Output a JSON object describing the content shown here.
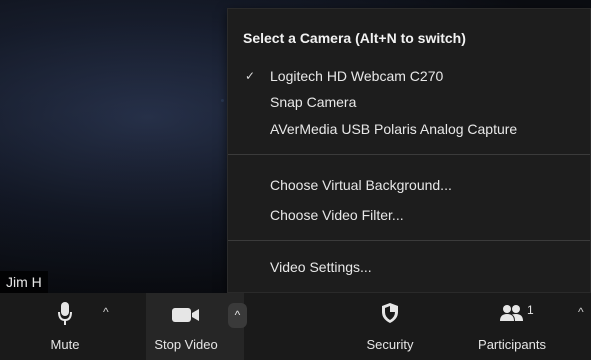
{
  "participant": {
    "name": "Jim H"
  },
  "camera_menu": {
    "title": "Select a Camera (Alt+N to switch)",
    "cameras": [
      {
        "label": "Logitech HD Webcam C270",
        "selected": true,
        "check": "✓"
      },
      {
        "label": "Snap Camera",
        "selected": false,
        "check": ""
      },
      {
        "label": "AVerMedia USB Polaris Analog Capture",
        "selected": false,
        "check": ""
      }
    ],
    "options": [
      {
        "label": "Choose Virtual Background..."
      },
      {
        "label": "Choose Video Filter..."
      }
    ],
    "settings_label": "Video Settings..."
  },
  "toolbar": {
    "mute_label": "Mute",
    "stop_video_label": "Stop Video",
    "security_label": "Security",
    "participants_label": "Participants",
    "participants_count": "1",
    "caret": "^"
  },
  "icons": {
    "mic": "microphone-icon",
    "video": "video-camera-icon",
    "security": "shield-icon",
    "participants": "people-icon"
  }
}
